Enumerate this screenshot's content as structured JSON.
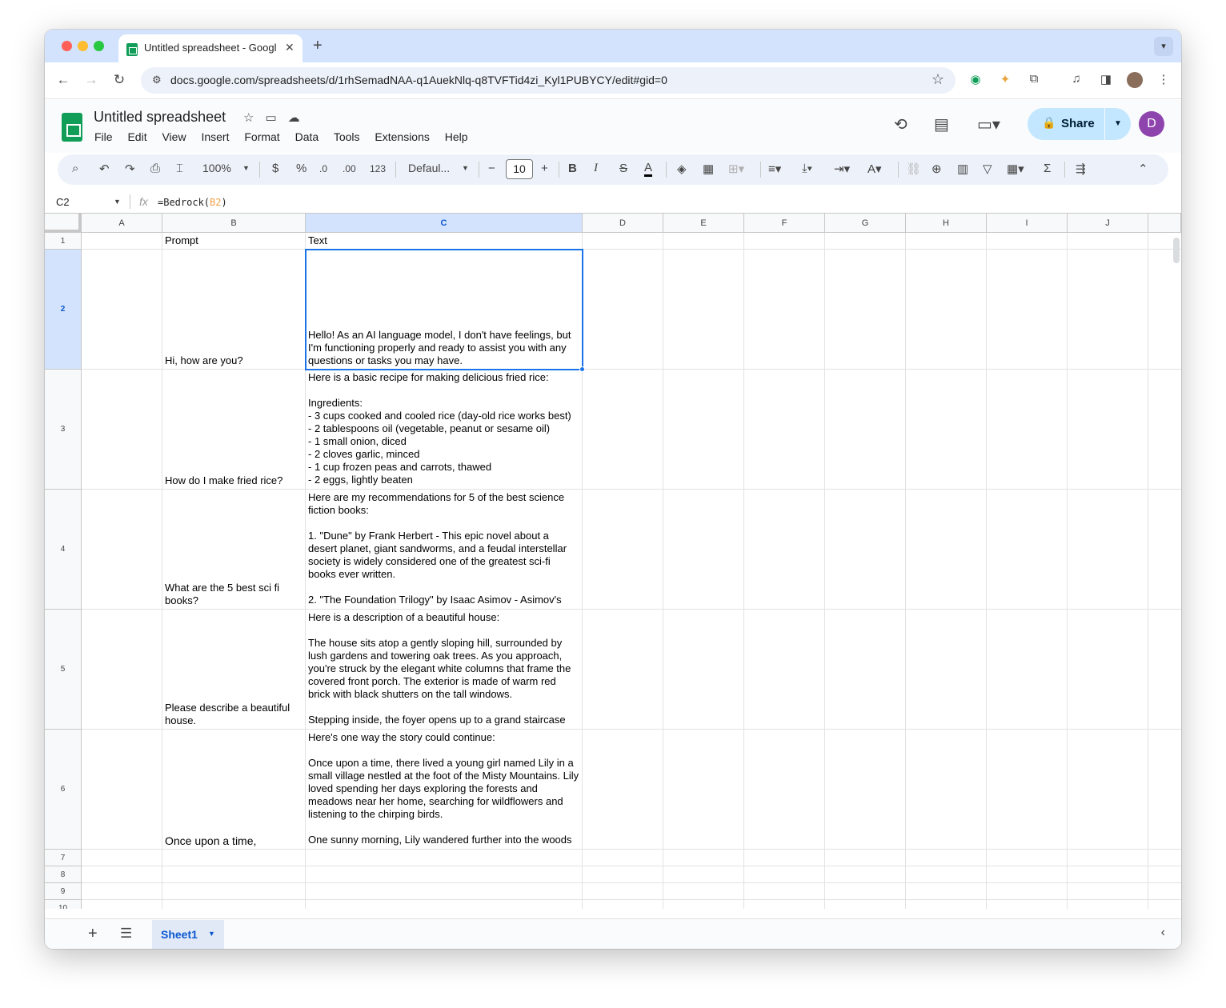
{
  "browser": {
    "tab_title": "Untitled spreadsheet - Google Sheets",
    "url": "docs.google.com/spreadsheets/d/1rhSemadNAA-q1AuekNlq-q8TVFTid4zi_Kyl1PUBYCY/edit#gid=0",
    "tab_close": "✕",
    "new_tab": "+"
  },
  "doc": {
    "title": "Untitled spreadsheet",
    "menu": [
      "File",
      "Edit",
      "View",
      "Insert",
      "Format",
      "Data",
      "Tools",
      "Extensions",
      "Help"
    ],
    "share_label": "Share",
    "avatar_initial": "D"
  },
  "toolbar": {
    "zoom": "100%",
    "currency": "$",
    "percent": "%",
    "decrease_decimal": ".0",
    "increase_decimal": ".00",
    "format_123": "123",
    "font": "Defaul...",
    "font_size": "10",
    "bold": "B",
    "italic": "I",
    "strikethrough": "S",
    "text_color": "A"
  },
  "formula_bar": {
    "name_box": "C2",
    "formula_prefix": "=Bedrock(",
    "formula_ref": "B2",
    "formula_suffix": ")"
  },
  "columns": [
    "A",
    "B",
    "C",
    "D",
    "E",
    "F",
    "G",
    "H",
    "I",
    "J"
  ],
  "rows": [
    {
      "num": "1",
      "B": "Prompt",
      "C": "Text"
    },
    {
      "num": "2",
      "B": "Hi, how are you?",
      "C": "Hello! As an AI language model, I don't have feelings, but I'm functioning properly and ready to assist you with any questions or tasks you may have."
    },
    {
      "num": "3",
      "B": "How do I make fried rice?",
      "C": "Here is a basic recipe for making delicious fried rice:\n\nIngredients:\n- 3 cups cooked and cooled rice (day-old rice works best)\n- 2 tablespoons oil (vegetable, peanut or sesame oil)\n- 1 small onion, diced\n- 2 cloves garlic, minced\n- 1 cup frozen peas and carrots, thawed\n- 2 eggs, lightly beaten"
    },
    {
      "num": "4",
      "B": "What are the 5 best sci fi books?",
      "C": "Here are my recommendations for 5 of the best science fiction books:\n\n1. \"Dune\" by Frank Herbert - This epic novel about a desert planet, giant sandworms, and a feudal interstellar society is widely considered one of the greatest sci-fi books ever written.\n\n2. \"The Foundation Trilogy\" by Isaac Asimov - Asimov's"
    },
    {
      "num": "5",
      "B": "Please describe a beautiful house.",
      "C": "Here is a description of a beautiful house:\n\nThe house sits atop a gently sloping hill, surrounded by lush gardens and towering oak trees. As you approach, you're struck by the elegant white columns that frame the covered front porch. The exterior is made of warm red brick with black shutters on the tall windows.\n\nStepping inside, the foyer opens up to a grand staircase"
    },
    {
      "num": "6",
      "B": "Once upon a time,",
      "C": "Here's one way the story could continue:\n\nOnce upon a time, there lived a young girl named Lily in a small village nestled at the foot of the Misty Mountains. Lily loved spending her days exploring the forests and meadows near her home, searching for wildflowers and listening to the chirping birds.\n\nOne sunny morning, Lily wandered further into the woods"
    },
    {
      "num": "7",
      "B": "",
      "C": ""
    },
    {
      "num": "8",
      "B": "",
      "C": ""
    },
    {
      "num": "9",
      "B": "",
      "C": ""
    },
    {
      "num": "10",
      "B": "",
      "C": ""
    }
  ],
  "sheets": [
    {
      "name": "Sheet1"
    }
  ],
  "selection": {
    "cell": "C2",
    "row": "2",
    "column": "C"
  }
}
